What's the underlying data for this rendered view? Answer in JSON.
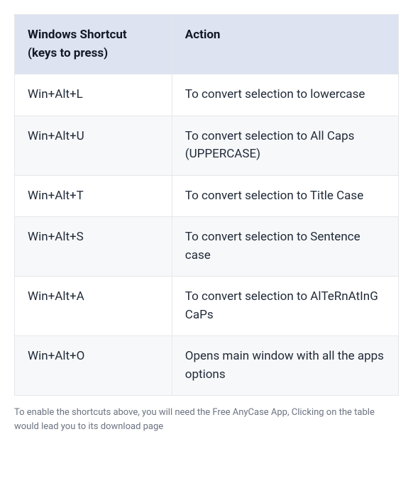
{
  "table": {
    "headers": {
      "shortcut": "Windows Shortcut (keys to press)",
      "action": "Action"
    },
    "rows": [
      {
        "shortcut": "Win+Alt+L",
        "action": "To convert selection to lowercase"
      },
      {
        "shortcut": "Win+Alt+U",
        "action": "To convert selection to All Caps (UPPERCASE)"
      },
      {
        "shortcut": "Win+Alt+T",
        "action": "To convert selection to Title Case"
      },
      {
        "shortcut": "Win+Alt+S",
        "action": "To convert selection to Sentence case"
      },
      {
        "shortcut": "Win+Alt+A",
        "action": "To convert selection to AlTeRnAtInG CaPs"
      },
      {
        "shortcut": "Win+Alt+O",
        "action": "Opens main window with all the apps options"
      }
    ]
  },
  "caption": "To enable the shortcuts above, you will need the Free AnyCase App, Clicking on the table would lead you to its download page"
}
